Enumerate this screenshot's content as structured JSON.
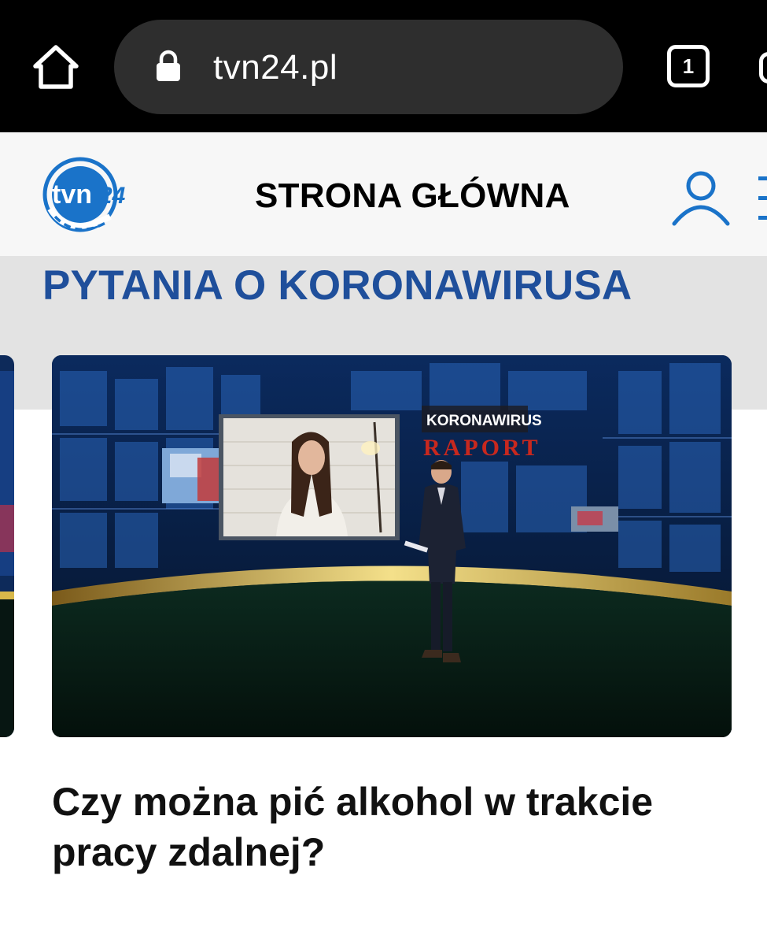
{
  "browser": {
    "url": "tvn24.pl",
    "tab_count": "1"
  },
  "header": {
    "logo_text": "tvn24",
    "title": "STRONA GŁÓWNA"
  },
  "section": {
    "title": "PYTANIA O KORONAWIRUSA"
  },
  "article": {
    "image_caption_line1": "KORONAWIRUS",
    "image_caption_line2": "RAPORT",
    "title": "Czy można pić alkohol w trakcie pracy zdalnej?"
  },
  "colors": {
    "browser_bar": "#000000",
    "url_pill": "#2e2e2e",
    "header_bg": "#f7f7f7",
    "section_band": "#e3e3e3",
    "section_title": "#1f4f9b",
    "brand_blue": "#1a73c9"
  },
  "icons": {
    "home": "home-icon",
    "lock": "lock-icon",
    "tabs": "tab-switcher-icon",
    "user": "user-icon",
    "menu": "hamburger-icon"
  }
}
